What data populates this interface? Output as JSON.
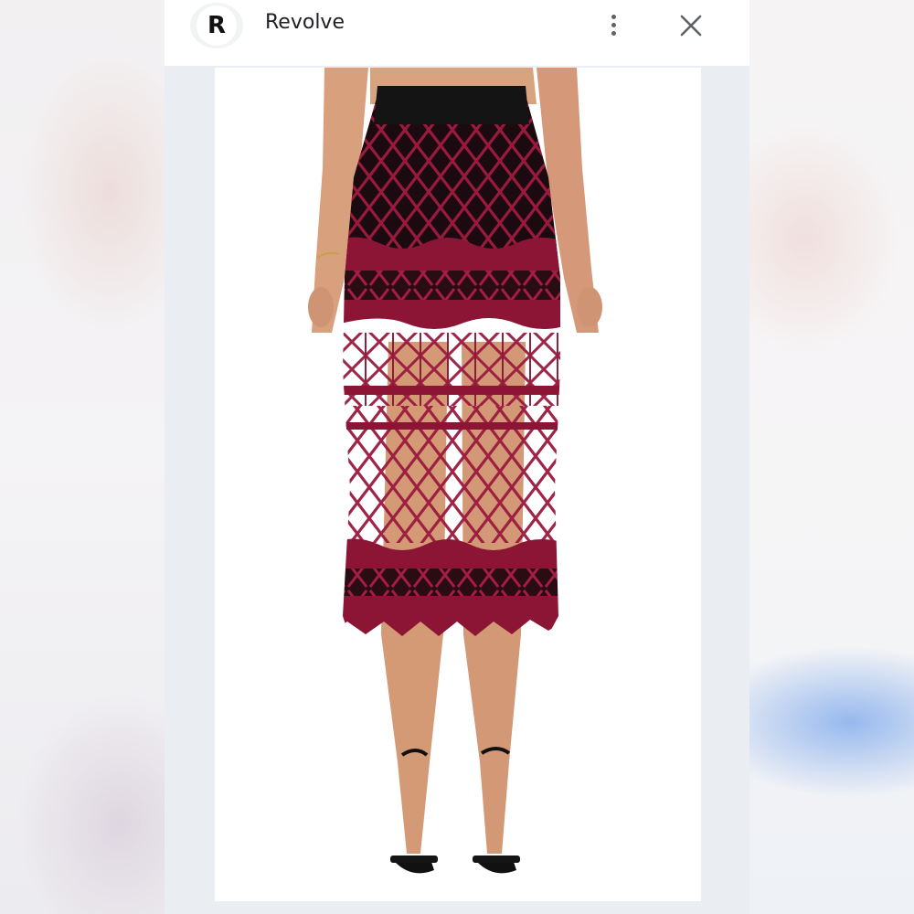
{
  "header": {
    "site_icon_letter": "R",
    "site_name": "Revolve",
    "menu_icon": "more-vert-icon",
    "close_icon": "close-icon"
  },
  "image": {
    "subject": "product-photo",
    "colors": {
      "skirt": "#8c1535",
      "lining": "#1a0d10",
      "waistband": "#121212",
      "skin": "#d9a07e",
      "background": "#ffffff"
    }
  }
}
